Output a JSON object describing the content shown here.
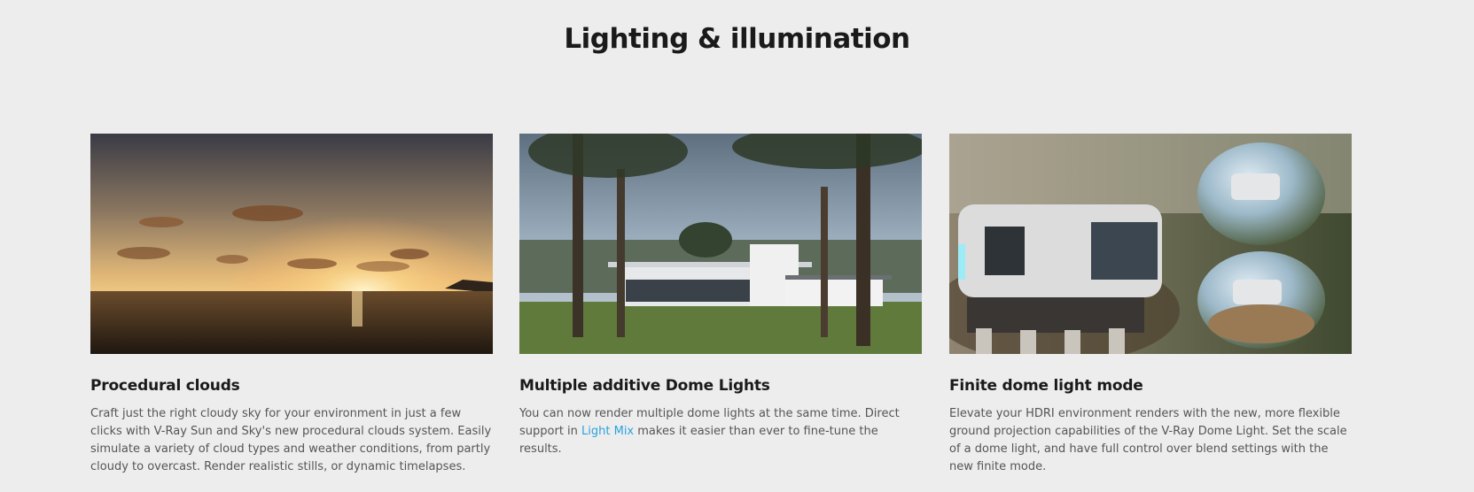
{
  "section": {
    "title": "Lighting & illumination"
  },
  "cards": [
    {
      "title": "Procedural clouds",
      "description": "Craft just the right cloudy sky for your environment in just a few clicks with V-Ray Sun and Sky's new procedural clouds system. Easily simulate a variety of cloud types and weather conditions, from partly cloudy to overcast. Render realistic stills, or dynamic timelapses."
    },
    {
      "title": "Multiple additive Dome Lights",
      "description_before": "You can now render multiple dome lights at the same time. Direct support in ",
      "link_text": "Light Mix",
      "description_after": " makes it easier than ever to fine-tune the results."
    },
    {
      "title": "Finite dome light mode",
      "description": "Elevate your HDRI environment renders with the new, more flexible ground projection capabilities of the V-Ray Dome Light. Set the scale of a dome light, and have full control over blend settings with the new finite mode."
    }
  ],
  "colors": {
    "background": "#ededed",
    "link": "#2aa3dc",
    "heading": "#1a1a1a",
    "body_text": "#555555"
  }
}
